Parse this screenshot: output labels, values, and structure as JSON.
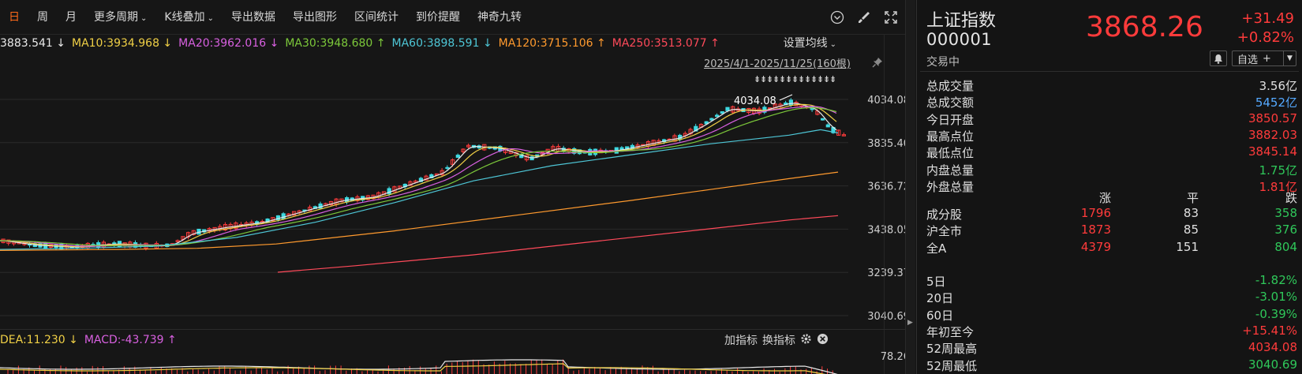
{
  "toolbar": {
    "items": [
      "日",
      "周",
      "月",
      "更多周期",
      "K线叠加",
      "导出数据",
      "导出图形",
      "区间统计",
      "到价提醒",
      "神奇九转"
    ],
    "active_index": 0
  },
  "ma_legend": [
    {
      "text": "3883.541 ↓",
      "color": "#e8e8e8"
    },
    {
      "text": "MA10:3934.968 ↓",
      "color": "#f0d046"
    },
    {
      "text": "MA20:3962.016 ↓",
      "color": "#d860e0"
    },
    {
      "text": "MA30:3948.680 ↑",
      "color": "#7cc83a"
    },
    {
      "text": "MA60:3898.591 ↓",
      "color": "#4ec6d6"
    },
    {
      "text": "MA120:3715.106 ↑",
      "color": "#ff9a2e"
    },
    {
      "text": "MA250:3513.077 ↑",
      "color": "#ff4a5a"
    }
  ],
  "ma_settings_label": "设置均线",
  "range_label": "2025/4/1-2025/11/25(160根)",
  "y_axis_labels": [
    "4034.08",
    "3835.40",
    "3636.72",
    "3438.05",
    "3239.37",
    "3040.69"
  ],
  "high_marker_label": "4034.08",
  "macd_legend": [
    {
      "text": "DEA:11.230 ↓",
      "color": "#f0d046"
    },
    {
      "text": "MACD:-43.739 ↑",
      "color": "#d860e0"
    }
  ],
  "macd_tools": {
    "add": "加指标",
    "switch": "换指标"
  },
  "macd_axis_label": "78.26",
  "quote": {
    "name": "上证指数",
    "code": "000001",
    "price": "3868.26",
    "change": "+31.49",
    "change_pct": "+0.82%",
    "status": "交易中",
    "watch_label": "自选",
    "watch_plus": "+",
    "stats": [
      {
        "label": "总成交量",
        "value": "3.56亿",
        "color": "white"
      },
      {
        "label": "总成交额",
        "value": "5452亿",
        "color": "blue"
      },
      {
        "label": "今日开盘",
        "value": "3850.57",
        "color": "red"
      },
      {
        "label": "最高点位",
        "value": "3882.03",
        "color": "red"
      },
      {
        "label": "最低点位",
        "value": "3845.14",
        "color": "red"
      },
      {
        "label": "内盘总量",
        "value": "1.75亿",
        "color": "green"
      },
      {
        "label": "外盘总量",
        "value": "1.81亿",
        "color": "red"
      }
    ],
    "breadth_header": {
      "up": "涨",
      "flat": "平",
      "down": "跌"
    },
    "breadth": [
      {
        "label": "成分股",
        "up": "1796",
        "flat": "83",
        "down": "358"
      },
      {
        "label": "沪全市",
        "up": "1873",
        "flat": "85",
        "down": "376"
      },
      {
        "label": "全A",
        "up": "4379",
        "flat": "151",
        "down": "804"
      }
    ],
    "periods": [
      {
        "label": "5日",
        "value": "-1.82%",
        "color": "green"
      },
      {
        "label": "20日",
        "value": "-3.01%",
        "color": "green"
      },
      {
        "label": "60日",
        "value": "-0.39%",
        "color": "green"
      },
      {
        "label": "年初至今",
        "value": "+15.41%",
        "color": "red"
      },
      {
        "label": "52周最高",
        "value": "4034.08",
        "color": "red"
      },
      {
        "label": "52周最低",
        "value": "3040.69",
        "color": "green"
      }
    ]
  }
}
